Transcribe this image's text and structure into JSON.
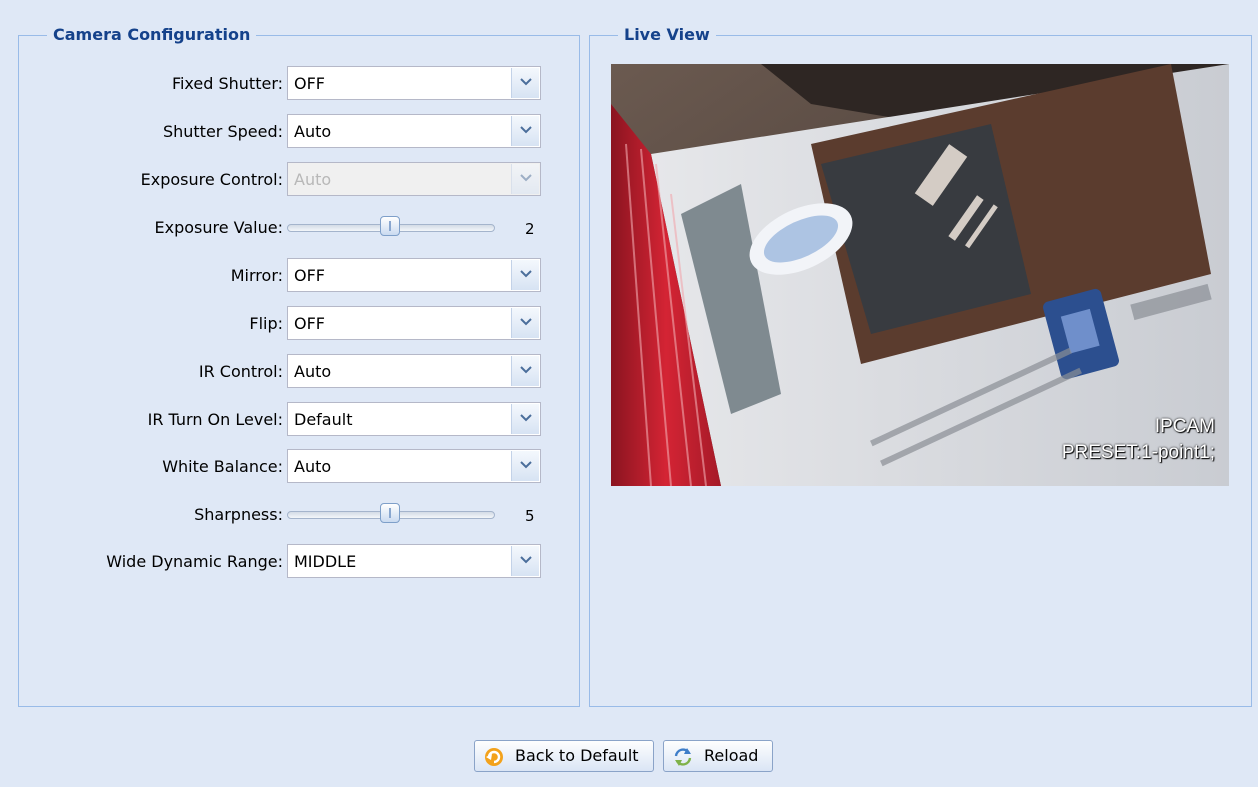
{
  "config_panel": {
    "title": "Camera Configuration",
    "fields": {
      "fixed_shutter": {
        "label": "Fixed Shutter:",
        "value": "OFF"
      },
      "shutter_speed": {
        "label": "Shutter Speed:",
        "value": "Auto"
      },
      "exposure_control": {
        "label": "Exposure Control:",
        "value": "Auto"
      },
      "exposure_value": {
        "label": "Exposure Value:",
        "value": "2",
        "level": 0.5
      },
      "mirror": {
        "label": "Mirror:",
        "value": "OFF"
      },
      "flip": {
        "label": "Flip:",
        "value": "OFF"
      },
      "ir_control": {
        "label": "IR Control:",
        "value": "Auto"
      },
      "ir_turn_on_level": {
        "label": "IR Turn On Level:",
        "value": "Default"
      },
      "white_balance": {
        "label": "White Balance:",
        "value": "Auto"
      },
      "sharpness": {
        "label": "Sharpness:",
        "value": "5",
        "level": 0.5
      },
      "wide_dynamic_range": {
        "label": "Wide Dynamic Range:",
        "value": "MIDDLE"
      }
    }
  },
  "live_panel": {
    "title": "Live View",
    "overlay_line1": "IPCAM",
    "overlay_line2": "PRESET:1-point1;"
  },
  "buttons": {
    "back_to_default": "Back to Default",
    "reload": "Reload"
  },
  "colors": {
    "background": "#dfe8f6",
    "legend_text": "#15428b",
    "border": "#99bbe8"
  }
}
